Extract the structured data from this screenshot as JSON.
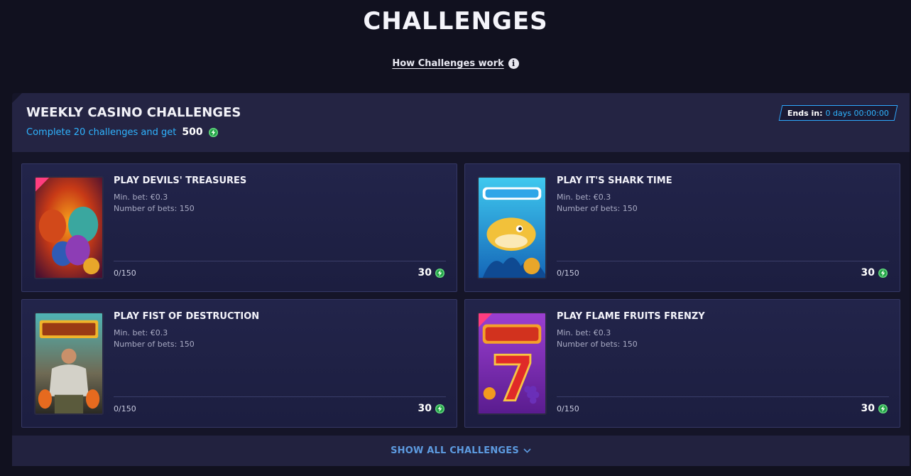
{
  "page": {
    "title": "CHALLENGES",
    "how_link": "How Challenges work",
    "info_glyph": "i"
  },
  "panel": {
    "title": "WEEKLY CASINO CHALLENGES",
    "subtitle": "Complete 20 challenges and get",
    "subtitle_amount": "500",
    "ends_label": "Ends in:",
    "ends_value": "0 days 00:00:00"
  },
  "cards": [
    {
      "title": "PLAY DEVILS' TREASURES",
      "min_bet": "Min. bet: €0.3",
      "num_bets": "Number of bets: 150",
      "progress": "0/150",
      "reward": "30",
      "thumb_text": "Devils Treasures"
    },
    {
      "title": "PLAY IT'S SHARK TIME",
      "min_bet": "Min. bet: €0.3",
      "num_bets": "Number of bets: 150",
      "progress": "0/150",
      "reward": "30",
      "thumb_text": "SharkTime!"
    },
    {
      "title": "PLAY FIST OF DESTRUCTION",
      "min_bet": "Min. bet: €0.3",
      "num_bets": "Number of bets: 150",
      "progress": "0/150",
      "reward": "30",
      "thumb_text": "Fist of Destruction"
    },
    {
      "title": "PLAY FLAME FRUITS FRENZY",
      "min_bet": "Min. bet: €0.3",
      "num_bets": "Number of bets: 150",
      "progress": "0/150",
      "reward": "30",
      "thumb_text": "Flame Fruits"
    }
  ],
  "footer": {
    "show_all": "SHOW ALL CHALLENGES"
  },
  "colors": {
    "accent": "#2fb4ff",
    "coin": "#22a447",
    "background": "#11111f",
    "card": "#22244a"
  },
  "icons": {
    "info": "info-icon",
    "coin": "coin-icon",
    "chevron": "chevron-down-icon"
  }
}
